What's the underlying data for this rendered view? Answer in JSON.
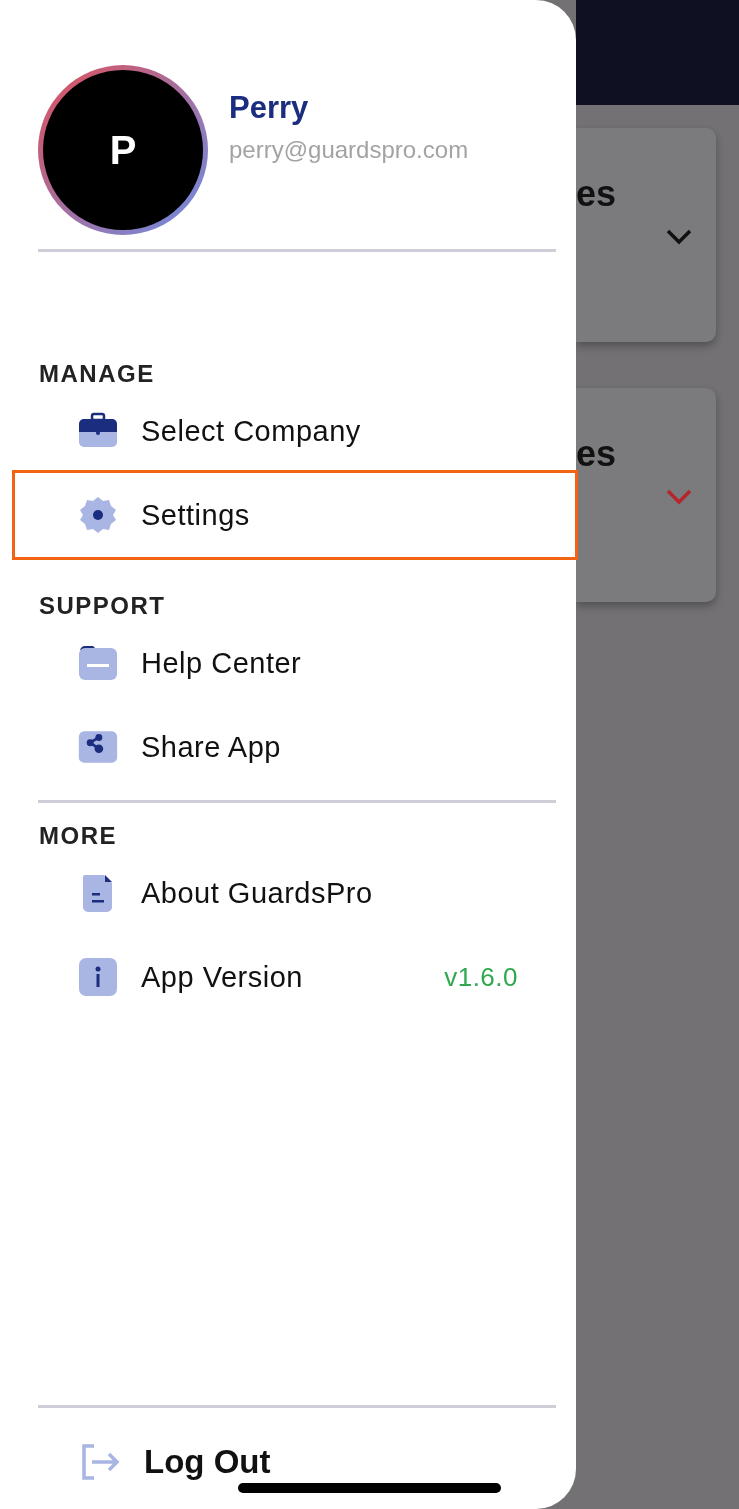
{
  "profile": {
    "initial": "P",
    "name": "Perry",
    "email": "perry@guardspro.com"
  },
  "sections": [
    {
      "title": "MANAGE",
      "divider": false,
      "items": [
        {
          "label": "Select Company",
          "selected": false
        },
        {
          "label": "Settings",
          "selected": true
        }
      ]
    },
    {
      "title": "SUPPORT",
      "divider": false,
      "items": [
        {
          "label": "Help Center",
          "selected": false
        },
        {
          "label": "Share App",
          "selected": false
        }
      ]
    },
    {
      "title": "MORE",
      "divider": true,
      "items": [
        {
          "label": "About GuardsPro",
          "selected": false
        },
        {
          "label": "App Version",
          "value": "v1.6.0",
          "selected": false
        }
      ]
    }
  ],
  "logout": {
    "label": "Log Out"
  },
  "background_cards": [
    {
      "title": "es",
      "color": "#111111"
    },
    {
      "title": "es",
      "color": "#b3262a"
    }
  ]
}
